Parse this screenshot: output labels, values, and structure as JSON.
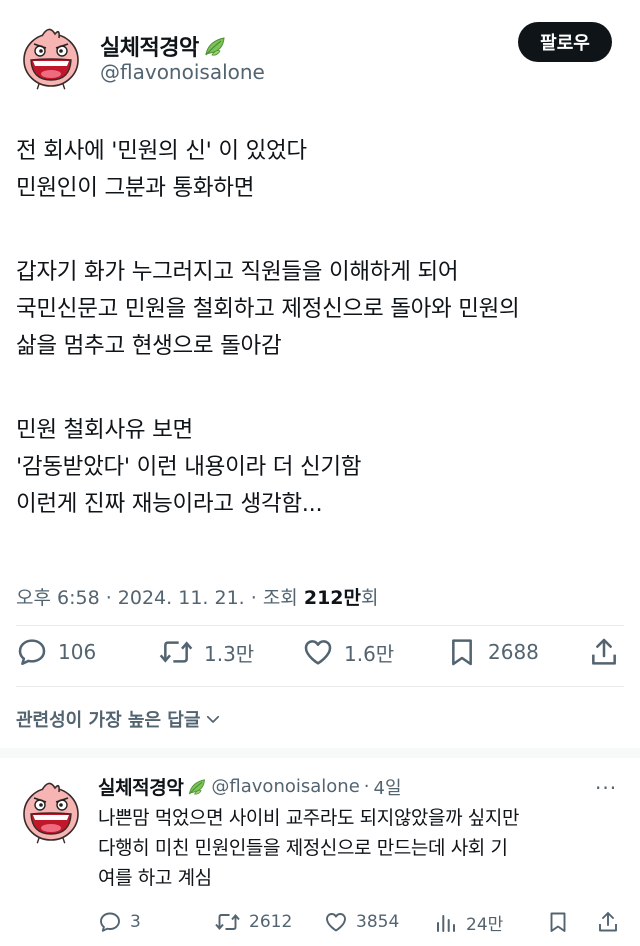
{
  "tweet": {
    "display_name": "실체적경악",
    "handle": "@flavonoisalone",
    "follow_label": "팔로우",
    "lines": [
      "전 회사에 '민원의 신' 이 있었다",
      "민원인이 그분과 통화하면",
      "",
      "갑자기  화가 누그러지고 직원들을 이해하게 되어",
      "국민신문고 민원을 철회하고 제정신으로 돌아와 민원의",
      "삶을 멈추고 현생으로 돌아감",
      "",
      "민원 철회사유 보면",
      "'감동받았다' 이런 내용이라 더 신기함",
      "이런게 진짜 재능이라고 생각함..."
    ],
    "time": "오후 6:58",
    "date": "2024. 11. 21.",
    "views_label": "조회",
    "views_count": "212만",
    "views_suffix": "회",
    "replies": "106",
    "retweets": "1.3만",
    "likes": "1.6만",
    "bookmarks": "2688"
  },
  "sort_label": "관련성이 가장 높은 답글",
  "reply": {
    "display_name": "실체적경악",
    "handle": "@flavonoisalone",
    "separator": "·",
    "time": "4일",
    "more": "···",
    "lines": [
      "나쁜맘 먹었으면 사이비 교주라도 되지않았을까 싶지만",
      "다행히 미친 민원인들을  제정신으로 만드는데 사회 기",
      "여를 하고 계심"
    ],
    "replies": "3",
    "retweets": "2612",
    "likes": "3854",
    "views": "24만"
  },
  "colors": {
    "text": "#0f1419",
    "secondary": "#536471",
    "divider": "#e7e9ea",
    "follow_bg": "#0f1419"
  },
  "icons": [
    "leaf-icon",
    "reply-icon",
    "retweet-icon",
    "like-icon",
    "bookmark-icon",
    "share-icon",
    "views-icon",
    "chevron-down-icon"
  ]
}
